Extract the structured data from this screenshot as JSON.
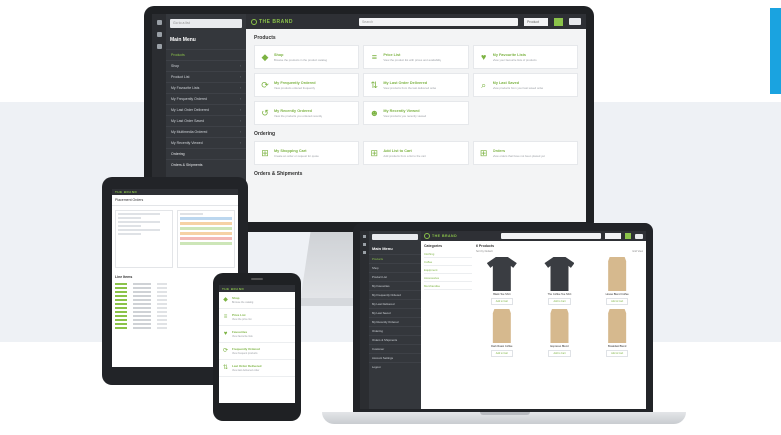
{
  "colors": {
    "accent": "#8bc34a",
    "sidebar": "#34373c",
    "band": "#eef1f5",
    "corner_bar": "#1aa3e0"
  },
  "monitor": {
    "search_placeholder": "Go to a list",
    "brand": "THE BRAND",
    "top_search_placeholder": "Search",
    "top_select": "Product",
    "menu_title": "Main Menu",
    "menu_items": [
      {
        "label": "Products",
        "active": true
      },
      {
        "label": "Shop"
      },
      {
        "label": "Product List"
      },
      {
        "label": "My Favourite Lists"
      },
      {
        "label": "My Frequently Ordered"
      },
      {
        "label": "My Last Order Delivered"
      },
      {
        "label": "My Last Order Saved"
      },
      {
        "label": "My Multimedia Ordered"
      },
      {
        "label": "My Recently Viewed"
      },
      {
        "label": "Ordering",
        "section": true
      },
      {
        "label": "Orders & Shipments",
        "section": true
      }
    ],
    "sections": [
      {
        "title": "Products",
        "cards": [
          {
            "icon": "tag-icon",
            "glyph": "◆",
            "title": "Shop",
            "desc": "Browse the products in the product catalog"
          },
          {
            "icon": "list-icon",
            "glyph": "≡",
            "title": "Price List",
            "desc": "View the product list with prices and availability"
          },
          {
            "icon": "heart-icon",
            "glyph": "♥",
            "title": "My Favourite Lists",
            "desc": "View your favourite lists of products"
          },
          {
            "icon": "refresh-icon",
            "glyph": "⟳",
            "title": "My Frequently Ordered",
            "desc": "View products ordered frequently"
          },
          {
            "icon": "delivered-icon",
            "glyph": "⇅",
            "title": "My Last Order Delivered",
            "desc": "View products from the last delivered order"
          },
          {
            "icon": "saved-search-icon",
            "glyph": "⌕",
            "title": "My Last Saved",
            "desc": "View products from your last saved order"
          },
          {
            "icon": "history-icon",
            "glyph": "↺",
            "title": "My Recently Ordered",
            "desc": "View the products you ordered recently"
          },
          {
            "icon": "users-icon",
            "glyph": "☻",
            "title": "My Recently Viewed",
            "desc": "View products you recently viewed"
          }
        ]
      },
      {
        "title": "Ordering",
        "cards": [
          {
            "icon": "cart-icon",
            "glyph": "⊞",
            "title": "My Shopping Cart",
            "desc": "Create an order or request for quote"
          },
          {
            "icon": "cart-add-icon",
            "glyph": "⊞",
            "title": "Add List to Cart",
            "desc": "Add products from a list to the cart"
          },
          {
            "icon": "cart-check-icon",
            "glyph": "⊞",
            "title": "Orders",
            "desc": "View orders that have not been placed yet"
          }
        ]
      },
      {
        "title": "Orders & Shipments",
        "cards": []
      }
    ]
  },
  "tablet": {
    "brand": "THE BRAND",
    "page_title": "Placement Orders",
    "sub_title": "Line Items"
  },
  "phone": {
    "brand": "THE BRAND",
    "items": [
      {
        "icon": "tag-icon",
        "glyph": "◆",
        "title": "Shop",
        "desc": "Browse the catalog"
      },
      {
        "icon": "list-icon",
        "glyph": "≡",
        "title": "Price List",
        "desc": "View the price list"
      },
      {
        "icon": "heart-icon",
        "glyph": "♥",
        "title": "Favourites",
        "desc": "View favourite lists"
      },
      {
        "icon": "refresh-icon",
        "glyph": "⟳",
        "title": "Frequently Ordered",
        "desc": "View frequent products"
      },
      {
        "icon": "delivered-icon",
        "glyph": "⇅",
        "title": "Last Order Delivered",
        "desc": "View last delivered order"
      }
    ]
  },
  "laptop": {
    "brand": "THE BRAND",
    "menu_title": "Main Menu",
    "menu_items": [
      {
        "label": "Products",
        "active": true
      },
      {
        "label": "Shop"
      },
      {
        "label": "Product List"
      },
      {
        "label": "My Favourites"
      },
      {
        "label": "My Frequently Ordered"
      },
      {
        "label": "My Last Delivered"
      },
      {
        "label": "My Last Saved"
      },
      {
        "label": "My Recently Ordered"
      },
      {
        "label": "Ordering"
      },
      {
        "label": "Orders & Shipments"
      },
      {
        "label": "Customer"
      },
      {
        "label": "Account Settings"
      },
      {
        "label": "Logout"
      }
    ],
    "categories_title": "Categories",
    "categories": [
      "Clothing",
      "Coffee",
      "Equipment",
      "Accessories",
      "Merchandise"
    ],
    "products_title": "6 Products",
    "sort_label": "Sort by Default",
    "view_label": "Grid View",
    "products": [
      {
        "kind": "tee",
        "name": "Black Tee Shirt",
        "button": "Add to Cart"
      },
      {
        "kind": "tee",
        "name": "The Coffee Tee Shirt",
        "button": "Add to Cart"
      },
      {
        "kind": "bag",
        "name": "House Blend Coffee",
        "button": "Add to Cart"
      },
      {
        "kind": "bag",
        "name": "Dark Roast Coffee",
        "button": "Add to Cart"
      },
      {
        "kind": "bag",
        "name": "Espresso Blend",
        "button": "Add to Cart"
      },
      {
        "kind": "bag",
        "name": "Breakfast Blend",
        "button": "Add to Cart"
      }
    ]
  }
}
